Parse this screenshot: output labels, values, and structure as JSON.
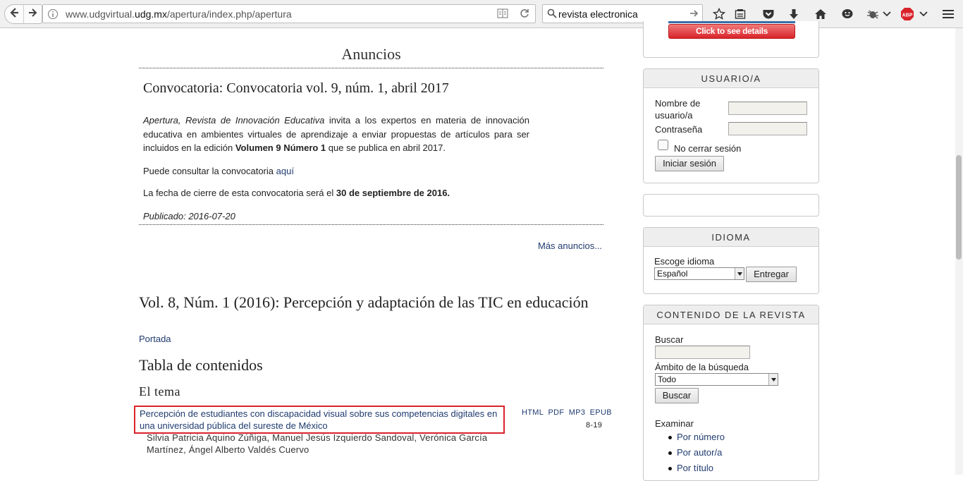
{
  "browser": {
    "url_prefix": "www.udgvirtual.",
    "url_domain": "udg.mx",
    "url_path": "/apertura/index.php/apertura",
    "search_value": "revista electronica"
  },
  "anuncios": {
    "title": "Anuncios",
    "item_title": "Convocatoria: Convocatoria vol. 9, núm. 1, abril 2017",
    "body_italic": "Apertura, Revista de Innovación Educativa",
    "body_text": " invita a los expertos en materia de innovación educativa en ambientes virtuales de aprendizaje a enviar propuestas de artículos para ser incluidos en la edición ",
    "body_bold": "Volumen 9 Número 1",
    "body_end": " que se publica en abril 2017.",
    "consult_text": "Puede consultar la convocatoria ",
    "consult_link": "aquí",
    "deadline_text": "La fecha de cierre de esta convocatoria será el ",
    "deadline_bold": "30 de septiembre de 2016.",
    "published": "Publicado: 2016-07-20",
    "more_link": "Más anuncios..."
  },
  "issue": {
    "title": "Vol. 8, Núm. 1 (2016): Percepción y adaptación de las TIC en educación",
    "cover_link": "Portada",
    "toc_heading": "Tabla de contenidos",
    "section_heading": "El tema",
    "articles": [
      {
        "title": "Percepción de estudiantes con discapacidad visual sobre sus competencias digitales en una universidad pública del sureste de México",
        "links": [
          "HTML",
          "PDF",
          "MP3",
          "EPUB"
        ],
        "pages": "8-19",
        "authors": "Silvia Patricia Aquino Zúñiga, Manuel Jesús Izquierdo Sandoval, Verónica García Martínez, Ángel Alberto Valdés Cuervo"
      }
    ]
  },
  "sidebar": {
    "badge_label": "Click to see details",
    "user": {
      "title": "USUARIO/A",
      "username_label": "Nombre de usuario/a",
      "password_label": "Contraseña",
      "remember_label": "No cerrar sesión",
      "login_button": "Iniciar sesión"
    },
    "language": {
      "title": "IDIOMA",
      "label": "Escoge idioma",
      "selected": "Español",
      "submit_button": "Entregar"
    },
    "journal": {
      "title": "CONTENIDO DE LA REVISTA",
      "search_label": "Buscar",
      "scope_label": "Ámbito de la búsqueda",
      "scope_selected": "Todo",
      "search_button": "Buscar",
      "browse_label": "Examinar",
      "browse_items": [
        "Por número",
        "Por autor/a",
        "Por título"
      ]
    }
  }
}
